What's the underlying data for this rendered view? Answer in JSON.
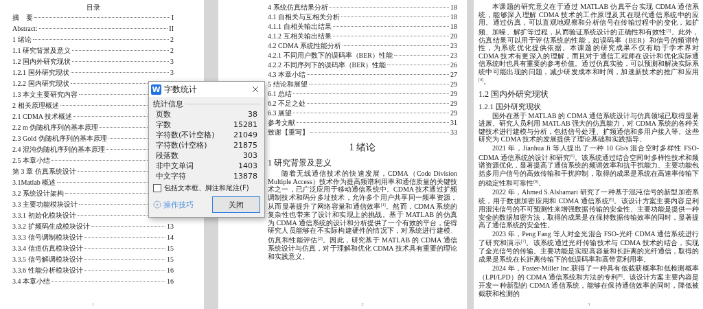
{
  "pages": [
    {
      "footer": "1",
      "blocks": [
        {
          "kind": "toc_title",
          "text": "目录"
        },
        {
          "kind": "toc_entry",
          "title": "摘　要",
          "page": "I"
        },
        {
          "kind": "toc_entry",
          "title": "Abstract:",
          "page": "II"
        },
        {
          "kind": "toc_entry",
          "title": "1 绪论",
          "page": "2"
        },
        {
          "kind": "toc_entry",
          "title": "1.1 研究背景及意义",
          "page": "2"
        },
        {
          "kind": "toc_entry",
          "title": "1.2 国内外研究现状",
          "page": "3"
        },
        {
          "kind": "toc_entry",
          "title": "1.2.1 国外研究现状",
          "page": "3"
        },
        {
          "kind": "toc_entry",
          "title": "1.2.2 国内研究现状"
        },
        {
          "kind": "toc_entry",
          "title": "1.3 本文主要研究内容"
        },
        {
          "kind": "toc_entry",
          "title": "2 相关原理概述"
        },
        {
          "kind": "toc_entry",
          "title": "2.1 CDMA 技术概述"
        },
        {
          "kind": "toc_entry",
          "title": "2.2 m 伪随机序列的基本原理"
        },
        {
          "kind": "toc_entry",
          "title": "2.3 Gold 伪随机序列的基本原理"
        },
        {
          "kind": "toc_entry",
          "title": "2.4  混沌伪随机序列的基本原理"
        },
        {
          "kind": "toc_entry",
          "title": "2.5 本章小结"
        },
        {
          "kind": "toc_entry",
          "title": "第 3 章  仿真系统设计"
        },
        {
          "kind": "toc_entry",
          "title": "3.1Matlab 概述"
        },
        {
          "kind": "toc_entry",
          "title": "3.2 系统设计架构"
        },
        {
          "kind": "toc_entry",
          "title": "3.3 主要功能模块设计"
        },
        {
          "kind": "toc_entry",
          "title": "3.3.1  初始化模块设计"
        },
        {
          "kind": "toc_entry",
          "title": "3.3.2  扩频码生成模块设计",
          "page": "13"
        },
        {
          "kind": "toc_entry",
          "title": "3.3.3  信号调制模块设计",
          "page": "14"
        },
        {
          "kind": "toc_entry",
          "title": "3.3.4  信道仿真模块设计",
          "page": "15"
        },
        {
          "kind": "toc_entry",
          "title": "3.3.5  信号解调模块设计",
          "page": "15"
        },
        {
          "kind": "toc_entry",
          "title": "3.3.6  性能分析模块设计",
          "page": "16"
        },
        {
          "kind": "toc_entry",
          "title": "3.4 本章小结",
          "page": "16"
        }
      ]
    },
    {
      "footer": "2",
      "blocks": [
        {
          "kind": "toc_entry",
          "title": "4  系统仿真结果分析",
          "page": "18"
        },
        {
          "kind": "toc_entry",
          "title": "4.1  自相关与互相关分析",
          "page": "18"
        },
        {
          "kind": "toc_entry",
          "title": "4.1.1  自相关输出结果",
          "page": "18"
        },
        {
          "kind": "toc_entry",
          "title": "4.1.2  互相关输出结果",
          "page": "20"
        },
        {
          "kind": "toc_entry",
          "title": "4.2 CDMA 系统性能分析",
          "page": "23"
        },
        {
          "kind": "toc_entry",
          "title": "4.2.1  不同用户数下的误码率（BER）性能",
          "page": "23"
        },
        {
          "kind": "toc_entry",
          "title": "4.2.2  不同序列下的误码率（BER）性能",
          "page": "26"
        },
        {
          "kind": "toc_entry",
          "title": "4.3  本章小结",
          "page": "27"
        },
        {
          "kind": "toc_entry",
          "title": "5  结论和展望",
          "page": "29"
        },
        {
          "kind": "toc_entry",
          "title": "6.1  总结",
          "page": "29"
        },
        {
          "kind": "toc_entry",
          "title": "6.2  不足之处",
          "page": "29"
        },
        {
          "kind": "toc_entry",
          "title": "6.3  展望",
          "page": "29"
        },
        {
          "kind": "toc_entry",
          "title": "参考文献",
          "page": "31"
        },
        {
          "kind": "toc_entry",
          "title": "致谢【重写】",
          "page": "33"
        },
        {
          "kind": "chapter",
          "text": "1 绪论"
        },
        {
          "kind": "section",
          "text": "1 研究背景及意义"
        },
        {
          "kind": "paragraph",
          "text": "随着无线通信技术的快速发展，CDMA（Code Division Multiple Access）技术作为提高频谱利用率和通信质量的关键技术之一，已广泛应用于移动通信系统中。CDMA 技术通过扩频调制技术和码分多址技术，允许多个用户共享同一频率资源，从而显著提升了网络容量和通信效率$^{[1]}$。然而，CDMA 系统的复杂性也带来了设计和实现上的挑战。基于 MATLAB 的仿真为 CDMA 通信系统的设计和分析提供了一个有效的平台，使得研究人员能够在不实际构建硬件的情况下，对系统进行建模、仿真和性能评估$^{[2]}$。因此，研究基于 MATLAB 的 CDMA 通信系统设计与仿真，对于理解和优化 CDMA 技术具有重要的理论和实践意义。"
        }
      ]
    },
    {
      "footer": "3",
      "blocks": [
        {
          "kind": "paragraph",
          "text": "本课题的研究意义在于通过 MATLAB 仿真平台实现 CDMA 通信系统，能够深入理解 CDMA 技术的工作原理及其在现代通信系统中的应用。通过仿真，可以直观地观察和分析信号在传输过程中的变化，如扩频、加噪、解扩等过程，从而验证系统设计的正确性和有效性$^{[3]}$。此外，仿真结果可以用于评估系统的性能，如误码率（BER）和信号的频谱特性，为系统优化提供依据。本课题的研究成果不仅有助于学术界对 CDMA 技术有更深入的理解，而且对于通信工程师在设计和优化实际通信系统时也具有重要的参考价值。通过仿真实验，可以预测和解决实际系统中可能出现的问题，减少研发成本和时间，加速新技术的推广和应用$^{[4]}$。"
        },
        {
          "kind": "section",
          "text": "1.2 国内外研究现状"
        },
        {
          "kind": "subsection",
          "text": "1.2.1 国外研究现状"
        },
        {
          "kind": "paragraph",
          "text": "国外在基于 MATLAB 的 CDMA 通信系统设计与仿真领域已取得显著进展。研究人员利用 MATLAB 强大的仿真能力，对 CDMA 系统的各种关键技术进行建模与分析，包括信号处理、扩频通信和多用户接入等。这些研究为 CDMA 技术的发展提供了理论基础和实践指导。"
        },
        {
          "kind": "paragraph",
          "text": "2021 年，Jianhua Ji 等人提出了一种 10 Gb/s 混合空时多样性 FSO-CDMA 通信系统的设计和研究$^{[5]}$。该系统通过结合空间时多样性技术和频谱资源优化，显著提高了通信系统的频谱效率和抗干扰能力。主要功能包括多用户信号的高效传输和干扰抑制，取得的成果是系统在高速率传输下的稳定性和可靠性$^{[6]}$。"
        },
        {
          "kind": "paragraph",
          "text": "2022 年，Ahmed S.Alshamari 研究了一种基于混沌信号的新型加密系统，用于数据加密应用和 CDMA 通信系统$^{[6]}$。该设计方案主要内容是利用混沌信号的不可预测性来增强数据传输的安全性。主要功能是提供一种安全的数据加密方法，取得的成果是在保持数据传输效率的同时，显著提高了通信系统的安全性。"
        },
        {
          "kind": "paragraph",
          "text": "2023 年，Peng Fang 等人对全光混合 FSO-光纤 CDMA 通信系统进行了研究和演示$^{[7]}$。该系统通过光纤传输技术与 CDMA 技术的结合，实现了全光信号的传输。主要功能是实现高容量和长距离的光纤通信，取得的成果是系统在长距离传输下的低误码率和高带宽利用率。"
        },
        {
          "kind": "paragraph",
          "text": "2024 年，Foster-Miller Inc.获得了一种具有低截获概率和低检测概率（LPI/LPD）的 CDMA 通信系统和方法的专利$^{[8]}$。该设计方案主要内容是开发一种新型的 CDMA 通信系统，能够在保持通信效率的同时，降低被截获和检测的"
        }
      ]
    }
  ],
  "dialog": {
    "app_icon": "W",
    "title": "字数统计",
    "group_label": "统计信息",
    "stats": [
      {
        "label": "页数",
        "value": "38"
      },
      {
        "label": "字数",
        "value": "15281"
      },
      {
        "label": "字符数(不计空格)",
        "value": "21049"
      },
      {
        "label": "字符数(计空格)",
        "value": "21875"
      },
      {
        "label": "段落数",
        "value": "303"
      },
      {
        "label": "非中文单词",
        "value": "1403"
      },
      {
        "label": "中文字符",
        "value": "13878"
      }
    ],
    "include_option": {
      "label": "包括文本框、脚注和尾注(F)",
      "checked": false
    },
    "tips_link": "操作技巧",
    "close_button": "关闭"
  }
}
